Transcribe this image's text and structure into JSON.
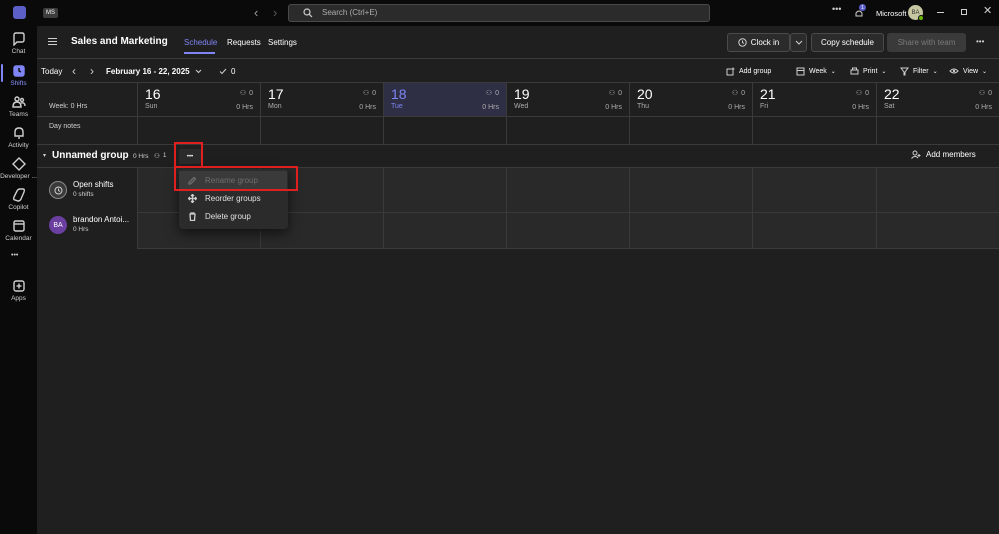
{
  "titlebar": {
    "org_badge": "MS",
    "search_placeholder": "Search (Ctrl+E)",
    "notification_count": "1",
    "account_name": "Microsoft",
    "avatar_initials": "BA"
  },
  "rail": {
    "items": [
      {
        "label": "Chat",
        "icon": "chat-icon"
      },
      {
        "label": "Shifts",
        "icon": "shifts-icon",
        "active": true
      },
      {
        "label": "Teams",
        "icon": "teams-icon"
      },
      {
        "label": "Activity",
        "icon": "bell-icon"
      },
      {
        "label": "Developer ...",
        "icon": "developer-icon"
      },
      {
        "label": "Copilot",
        "icon": "copilot-icon"
      },
      {
        "label": "Calendar",
        "icon": "calendar-icon"
      },
      {
        "label": "Apps",
        "icon": "plus-icon"
      }
    ],
    "more": "•••"
  },
  "header": {
    "team_name": "Sales and Marketing",
    "tabs": [
      {
        "label": "Schedule",
        "active": true
      },
      {
        "label": "Requests"
      },
      {
        "label": "Settings"
      }
    ],
    "clock_in": "Clock in",
    "copy_schedule": "Copy schedule",
    "share_with_team": "Share with team"
  },
  "toolbar": {
    "today": "Today",
    "date_range": "February 16 - 22, 2025",
    "check_count": "0",
    "add_group": "Add group",
    "week": "Week",
    "print": "Print",
    "filter": "Filter",
    "view": "View"
  },
  "week_summary": {
    "label": "Week: 0 Hrs",
    "day_notes": "Day notes"
  },
  "days": [
    {
      "num": "16",
      "name": "Sun",
      "count": "0",
      "hrs": "0 Hrs"
    },
    {
      "num": "17",
      "name": "Mon",
      "count": "0",
      "hrs": "0 Hrs"
    },
    {
      "num": "18",
      "name": "Tue",
      "count": "0",
      "hrs": "0 Hrs",
      "today": true
    },
    {
      "num": "19",
      "name": "Wed",
      "count": "0",
      "hrs": "0 Hrs"
    },
    {
      "num": "20",
      "name": "Thu",
      "count": "0",
      "hrs": "0 Hrs"
    },
    {
      "num": "21",
      "name": "Fri",
      "count": "0",
      "hrs": "0 Hrs"
    },
    {
      "num": "22",
      "name": "Sat",
      "count": "0",
      "hrs": "0 Hrs"
    }
  ],
  "group": {
    "name": "Unnamed group",
    "hrs": "0 Hrs",
    "members": "1",
    "more": "•••",
    "add_members": "Add members"
  },
  "rows": [
    {
      "name": "Open shifts",
      "sub": "0 shifts"
    },
    {
      "name": "brandon Antoi...",
      "sub": "0 Hrs",
      "initials": "BA"
    }
  ],
  "context_menu": {
    "items": [
      {
        "label": "Rename group",
        "icon": "pencil-icon",
        "disabled": true
      },
      {
        "label": "Reorder groups",
        "icon": "move-icon"
      },
      {
        "label": "Delete group",
        "icon": "trash-icon"
      }
    ]
  },
  "colors": {
    "accent": "#7f85f5",
    "highlight": "#e02020",
    "avatar_ba": "#6b3fa0"
  }
}
